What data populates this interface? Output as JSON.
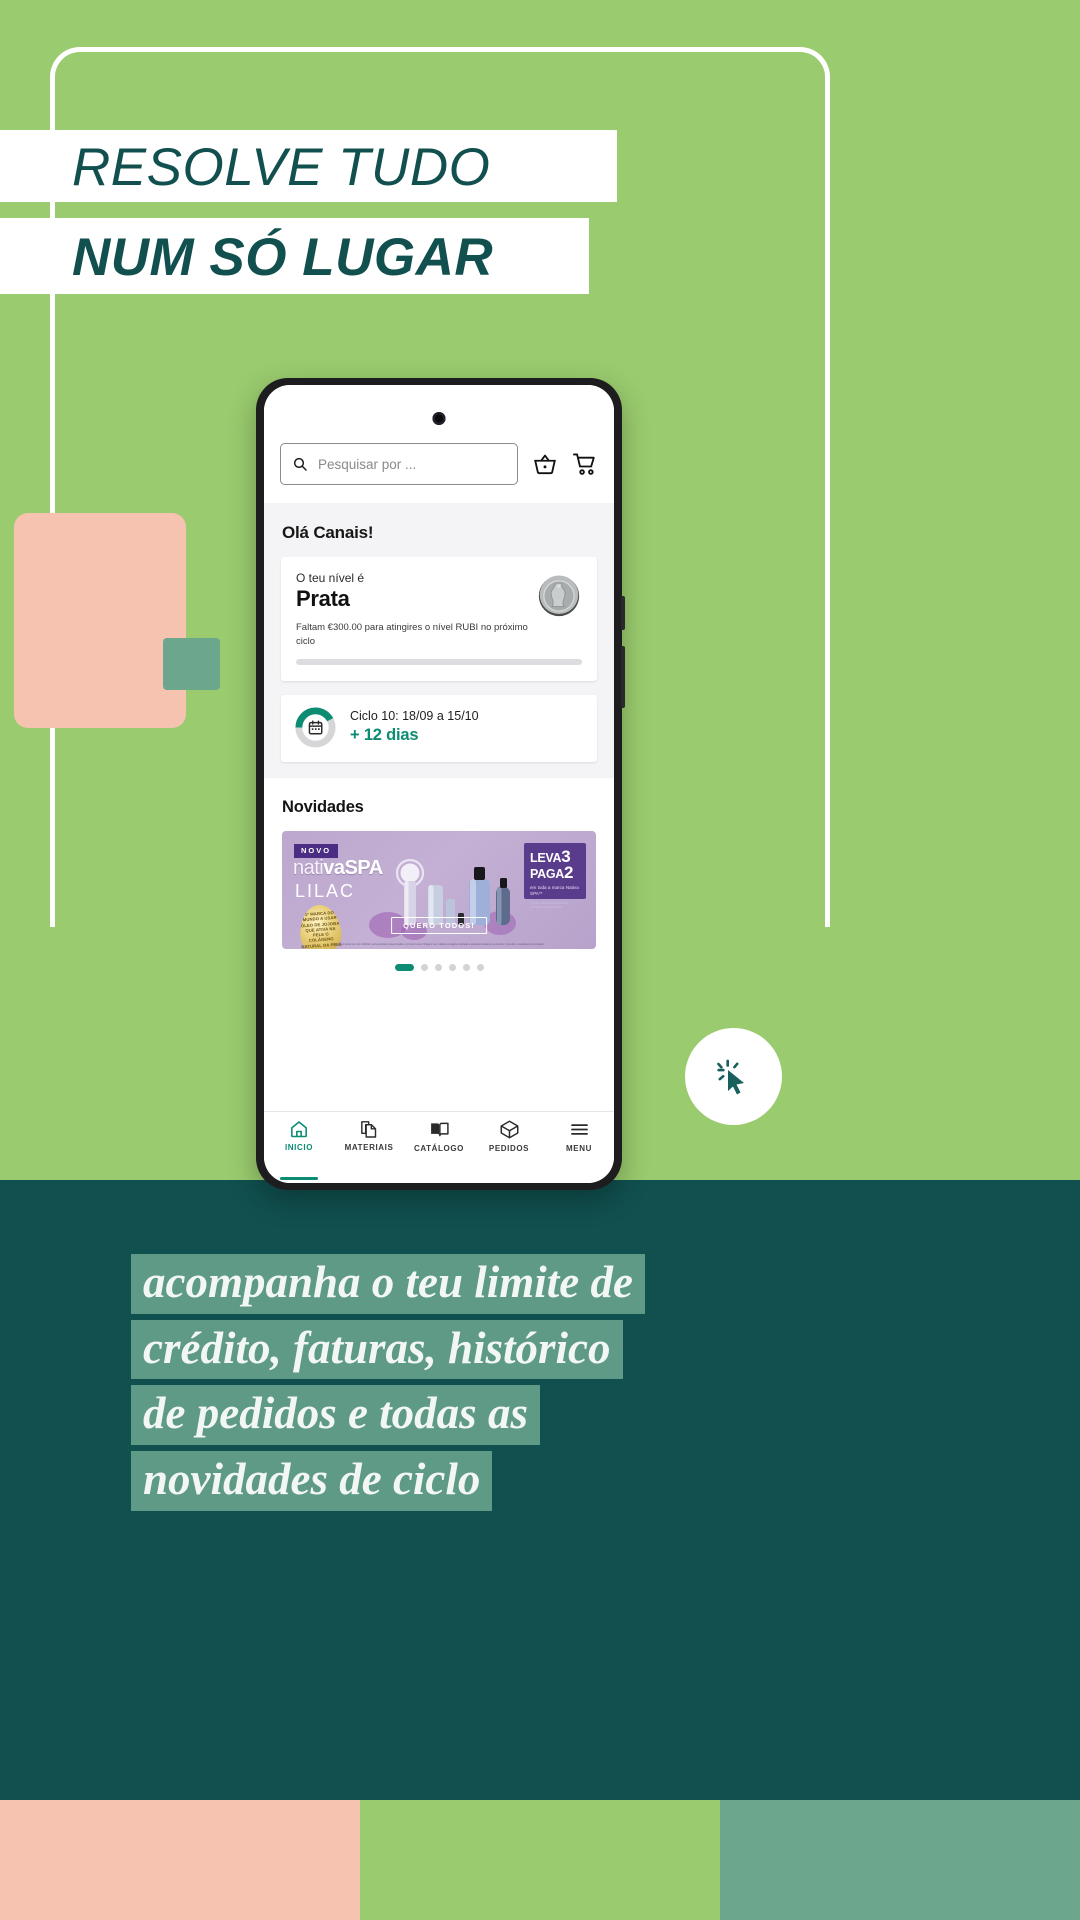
{
  "colors": {
    "green": "#9ACB6E",
    "teal": "#10504F",
    "peach": "#F6C3B0",
    "muted_green": "#6CA68D",
    "accent_teal": "#0C8C73",
    "headline_teal": "#11504E",
    "script_band": "#5E9A86"
  },
  "headline": {
    "line1": "RESOLVE TUDO",
    "line2": "NUM SÓ LUGAR"
  },
  "cursor_badge": {
    "icon": "click-cursor-icon"
  },
  "phone": {
    "app": {
      "search": {
        "placeholder": "Pesquisar por ...",
        "icon": "search-icon"
      },
      "header_icons": [
        {
          "name": "basket-icon",
          "label": "Cesto"
        },
        {
          "name": "cart-icon",
          "label": "Carrinho"
        }
      ],
      "greeting": "Olá Canais!",
      "level_card": {
        "sub": "O teu nível é",
        "name": "Prata",
        "note": "Faltam €300.00 para atingires o nível RUBI no próximo ciclo",
        "progress_percent": 0,
        "badge_icon": "silver-medal-icon"
      },
      "cycle_card": {
        "icon": "calendar-icon",
        "title": "Ciclo 10: 18/09 a 15/10",
        "days": "+ 12 dias",
        "ring_percent": 42
      },
      "novidades": {
        "title": "Novidades",
        "banner": {
          "novo": "NOVO",
          "brand_light": "nati",
          "brand_bold": "vaSPA",
          "brand_full": "nativaSPA",
          "product": "LILAC",
          "seal": "1ª MARCA DO MUNDO A USAR ÓLEO DE JOJOBA QUE ATIVA NA PELE O COLÁGENO NATURAL DA PELE",
          "promo_line1": "LEVA",
          "promo_num1": "3",
          "promo_line2": "PAGA",
          "promo_num2": "2",
          "promo_sub": "em toda a marca Nativa SPA**",
          "promo_sub2": "Promo válida somente nos produtos selecionados",
          "cta": "QUERO TODOS!",
          "legal": "Válido somente no mês 10/2024, para produtos selecionados. A promo Leva 3 Paga 2 só é válida na página indicada e enquanto durarem os stocks. Consulte o regulamento completo."
        },
        "carousel": {
          "total_dots": 6,
          "active_index": 0
        }
      },
      "bottom_nav": [
        {
          "label": "INICIO",
          "icon": "home-icon",
          "active": true
        },
        {
          "label": "MATERIAIS",
          "icon": "documents-icon",
          "active": false
        },
        {
          "label": "CATÁLOGO",
          "icon": "book-icon",
          "active": false
        },
        {
          "label": "PEDIDOS",
          "icon": "box-icon",
          "active": false
        },
        {
          "label": "MENU",
          "icon": "hamburger-icon",
          "active": false
        }
      ]
    }
  },
  "script_text": {
    "line1": "acompanha o teu limite de",
    "line2": "crédito, faturas, histórico",
    "line3": "de pedidos e todas as",
    "line4": "novidades de ciclo"
  },
  "bottom_strip": [
    "#F6C3B0",
    "#9ACB6E",
    "#6CA68D"
  ]
}
